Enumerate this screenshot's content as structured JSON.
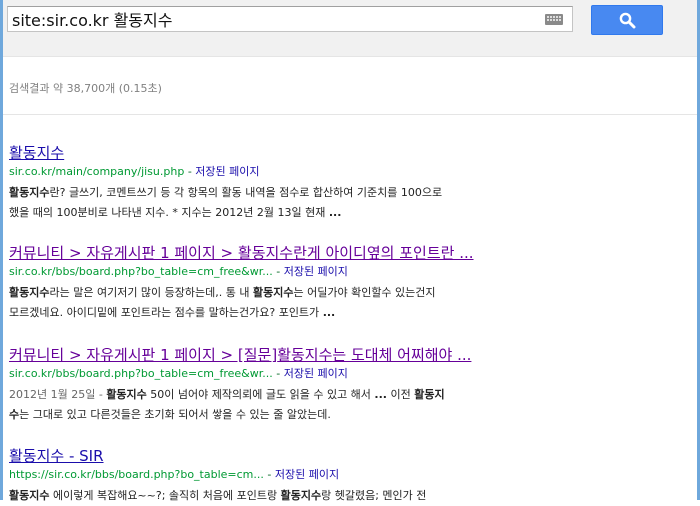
{
  "search": {
    "query": "site:sir.co.kr 활동지수"
  },
  "stats": "검색결과 약 38,700개 (0.15초)",
  "results": [
    {
      "title": [
        {
          "t": "활동지수",
          "b": false
        }
      ],
      "url": "sir.co.kr/main/company/jisu.php",
      "sep": " - ",
      "cache": "저장된 페이지",
      "lines": [
        [
          {
            "t": "활동지수",
            "b": true
          },
          {
            "t": "란? 글쓰기, 코멘트쓰기 등 각 항목의 활동 내역을 점수로 합산하여 기준치를 100으로",
            "b": false
          }
        ],
        [
          {
            "t": "했을 때의 100분비로 나타낸 지수. * 지수는 2012년 2월 13일 현재 ",
            "b": false
          },
          {
            "t": "...",
            "b": true
          }
        ]
      ]
    },
    {
      "title": [
        {
          "t": "커뮤니티 > 자유게시판 1 페이지 > ",
          "b": false
        },
        {
          "t": "활동지수",
          "b": false
        },
        {
          "t": "란게 아이디옆의 포인트란 ...",
          "b": false
        }
      ],
      "url": "sir.co.kr/bbs/board.php?bo_table=cm_free&wr...",
      "sep": " - ",
      "cache": "저장된 페이지",
      "lines": [
        [
          {
            "t": "활동지수",
            "b": true
          },
          {
            "t": "라는 말은 여기저기 많이 등장하는데,. 통 내 ",
            "b": false
          },
          {
            "t": "활동지수",
            "b": true
          },
          {
            "t": "는 어딜가야 확인할수 있는건지",
            "b": false
          }
        ],
        [
          {
            "t": "모르겠네요. 아이디밑에 포인트라는 점수를 말하는건가요? 포인트가 ",
            "b": false
          },
          {
            "t": "...",
            "b": true
          }
        ]
      ]
    },
    {
      "title": [
        {
          "t": "커뮤니티 > 자유게시판 1 페이지 > [질문]",
          "b": false
        },
        {
          "t": "활동지수",
          "b": false
        },
        {
          "t": "는 도대체 어찌해야 ...",
          "b": false
        }
      ],
      "url": "sir.co.kr/bbs/board.php?bo_table=cm_free&wr...",
      "sep": " - ",
      "cache": "저장된 페이지",
      "lines": [
        [
          {
            "t": "2012년 1월 25일 - ",
            "b": false,
            "d": true
          },
          {
            "t": "활동지수",
            "b": true
          },
          {
            "t": " 50이 넘어야 제작의뢰에 글도 읽을 수 있고 해서 ",
            "b": false
          },
          {
            "t": "...",
            "b": true
          },
          {
            "t": " 이전 ",
            "b": false
          },
          {
            "t": "활동지",
            "b": true
          }
        ],
        [
          {
            "t": "수",
            "b": true
          },
          {
            "t": "는 그대로 있고 다른것들은 초기화 되어서 쌓을 수 있는 줄 알았는데.",
            "b": false
          }
        ]
      ]
    },
    {
      "title": [
        {
          "t": "활동지수 - SIR",
          "b": false
        }
      ],
      "url": "https://sir.co.kr/bbs/board.php?bo_table=cm...",
      "sep": " - ",
      "cache": "저장된 페이지",
      "lines": [
        [
          {
            "t": "활동지수",
            "b": true
          },
          {
            "t": " 에이렇게 복잡해요~~?; 솔직히 처음에 포인트랑 ",
            "b": false
          },
          {
            "t": "활동지수",
            "b": true
          },
          {
            "t": "랑 헷갈렸음; 멘인가 전",
            "b": false
          }
        ]
      ]
    }
  ]
}
